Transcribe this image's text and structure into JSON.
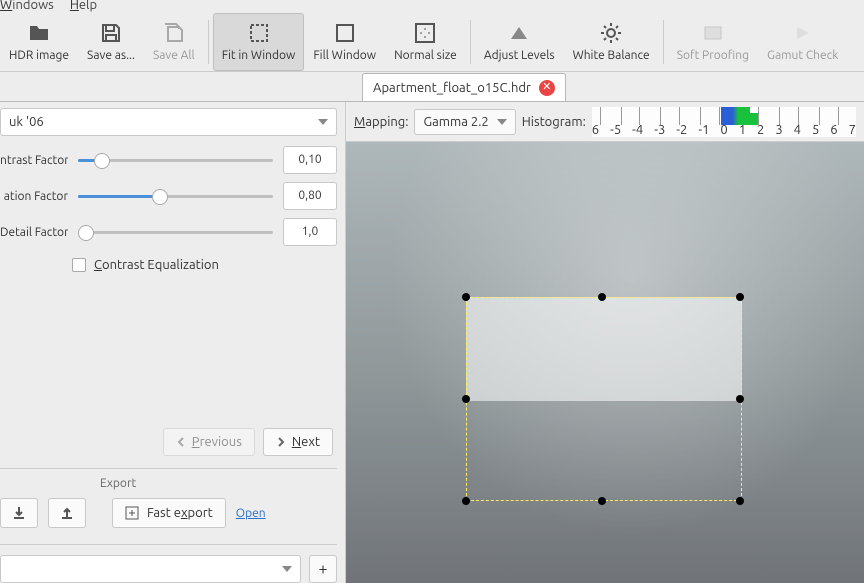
{
  "menu": {
    "windows": "indows",
    "help": "elp",
    "windows_u": "W",
    "help_u": "H"
  },
  "toolbar": {
    "hdr": "HDR image",
    "saveas": "Save as...",
    "saveall": "Save All",
    "fit": "Fit in Window",
    "fill": "Fill Window",
    "normal": "Normal size",
    "levels": "Adjust Levels",
    "wb": "White Balance",
    "soft": "Soft Proofing",
    "gamut": "Gamut Check"
  },
  "tab": {
    "name": "Apartment_float_o15C.hdr"
  },
  "operator": {
    "name": "uk '06"
  },
  "sliders": {
    "contrast": {
      "label": "ntrast Factor",
      "value": "0,10",
      "pct": 10
    },
    "saturation": {
      "label": "ation Factor",
      "value": "0,80",
      "pct": 40
    },
    "detail": {
      "label": "Detail Factor",
      "value": "1,0",
      "pct": 2
    }
  },
  "checkbox": {
    "label": "ontrast Equalization",
    "u": "C"
  },
  "nav": {
    "prev": "revious",
    "prev_u": "P",
    "next": "ext",
    "next_u": "N"
  },
  "export": {
    "title": "Export",
    "fast": "Fast e",
    "fast_u": "x",
    "fast_end": "port",
    "open": "Open"
  },
  "viewer": {
    "mapping_u": "M",
    "mapping": "apping:",
    "mapping_val": "Gamma 2.2",
    "histogram": "Histogram:"
  },
  "hist_ticks": [
    "6",
    "-5",
    "-4",
    "-3",
    "-2",
    "-1",
    "0",
    "1",
    "2",
    "3",
    "4",
    "5",
    "6",
    "7"
  ],
  "add": "+"
}
